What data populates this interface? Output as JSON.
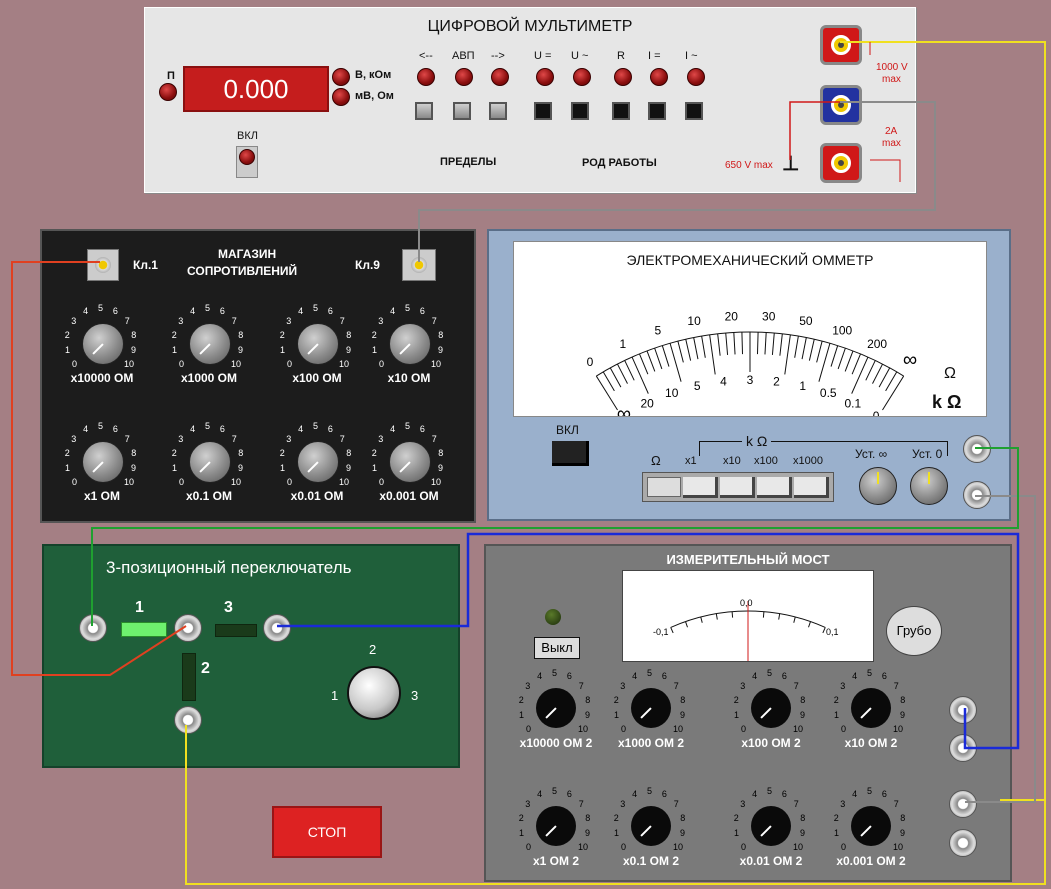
{
  "multimeter": {
    "title": "ЦИФРОВОЙ МУЛЬТИМЕТР",
    "power_label": "П",
    "display": "0.000",
    "unit_top": "В, кОм",
    "unit_bottom": "мВ, Ом",
    "on_label": "ВКЛ",
    "range_buttons": [
      "<--",
      "АВП",
      "-->"
    ],
    "mode_buttons": [
      "U =",
      "U ~",
      "R",
      "I =",
      "I ~"
    ],
    "limits_label": "ПРЕДЕЛЫ",
    "mode_label": "РОД РАБОТЫ",
    "max_1000": "1000 V",
    "max_word": "max",
    "max_2a": "2A",
    "max_650": "650 V max",
    "ground": "⊥"
  },
  "resistance_box": {
    "title_line1": "МАГАЗИН",
    "title_line2": "СОПРОТИВЛЕНИЙ",
    "key1": "Кл.1",
    "key9": "Кл.9",
    "dials": [
      "x10000 ОМ",
      "x1000 ОМ",
      "x100 ОМ",
      "x10 ОМ",
      "x1 ОМ",
      "x0.1 ОМ",
      "x0.01 ОМ",
      "x0.001 ОМ"
    ],
    "dial_numbers": [
      "0",
      "1",
      "2",
      "3",
      "4",
      "5",
      "6",
      "7",
      "8",
      "9",
      "10"
    ]
  },
  "ohmmeter": {
    "title": "ЭЛЕКТРОМЕХАНИЧЕСКИЙ ОММЕТР",
    "upper_scale": [
      "0",
      "1",
      "5",
      "10",
      "20",
      "30",
      "50",
      "100",
      "200",
      "∞"
    ],
    "lower_scale": [
      "∞",
      "20",
      "10",
      "5",
      "4",
      "3",
      "2",
      "1",
      "0.5",
      "0.1",
      "0"
    ],
    "unit_ohm": "Ω",
    "unit_kohm": "k Ω",
    "on_label": "ВКЛ",
    "range_ohm": "Ω",
    "range_group": "k Ω",
    "ranges": [
      "x1",
      "x10",
      "x100",
      "x1000"
    ],
    "set_inf": "Уст. ∞",
    "set_zero": "Уст. 0"
  },
  "switch3": {
    "title": "3-позиционный переключатель",
    "pos1": "1",
    "pos2": "2",
    "pos3": "3",
    "knob_1": "1",
    "knob_2": "2",
    "knob_3": "3"
  },
  "bridge": {
    "title": "ИЗМЕРИТЕЛЬНЫЙ МОСТ",
    "off_button": "Выкл",
    "coarse_button": "Грубо",
    "meter_left": "-0,1",
    "meter_center": "0,0",
    "meter_right": "0,1",
    "dials": [
      "x10000 ОМ 2",
      "x1000 ОМ 2",
      "x100 ОМ 2",
      "x10 ОМ 2",
      "x1 ОМ 2",
      "x0.1 ОМ 2",
      "x0.01 ОМ 2",
      "x0.001 ОМ 2"
    ]
  },
  "stop_button": "СТОП",
  "colors": {
    "yellow_wire": "#f0e020",
    "gray_wire": "#8a8a8a",
    "red_wire": "#e04020",
    "green_wire": "#1fa030",
    "blue_wire": "#1a2ad8"
  }
}
